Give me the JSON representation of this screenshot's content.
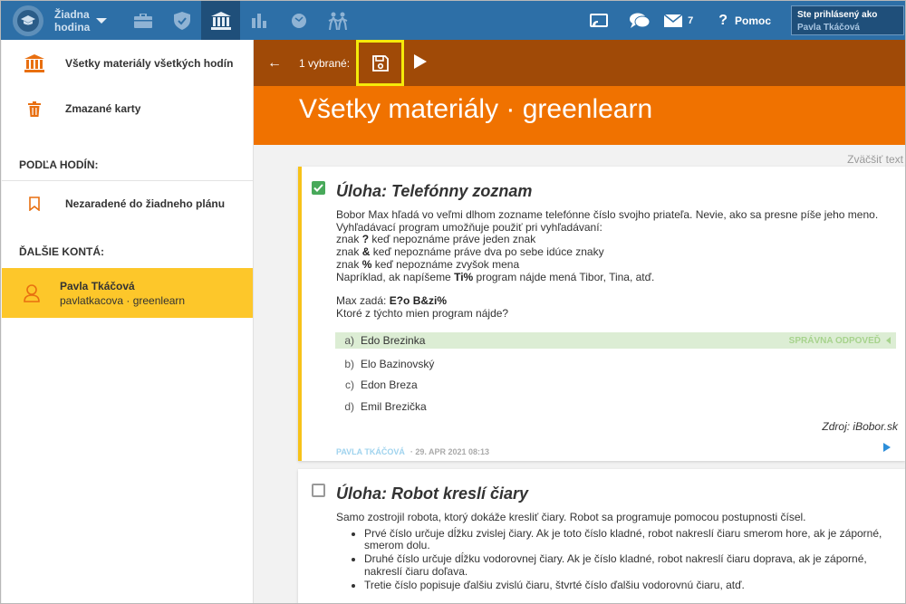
{
  "topbar": {
    "hour_line1": "Žiadna",
    "hour_line2": "hodina",
    "icons": [
      "briefcase-icon",
      "shield-check-icon",
      "bank-icon",
      "bar-chart-icon",
      "tomato-icon",
      "children-icon"
    ],
    "message_count": "7",
    "help_label": "Pomoc",
    "help_mark": "?",
    "signed_in_label": "Ste prihlásený ako",
    "signed_in_user": "Pavla Tkáčová"
  },
  "sidebar": {
    "item_all": "Všetky materiály všetkých hodín",
    "item_deleted": "Zmazané karty",
    "section_by_hour": "PODĽA HODÍN:",
    "item_unassigned": "Nezaradené do žiadneho plánu",
    "section_accounts": "ĎALŠIE KONTÁ:",
    "account_name": "Pavla Tkáčová",
    "account_sub": "pavlatkacova · greenlearn"
  },
  "actionbar": {
    "back_arrow": "←",
    "selected": "1 vybrané:"
  },
  "title": "Všetky materiály · greenlearn",
  "zoom_label": "Zväčšiť text",
  "card1": {
    "checked": true,
    "title": "Úloha: Telefónny zoznam",
    "p1": "Bobor Max hľadá vo veľmi dlhom zozname telefónne číslo svojho priateľa. Nevie, ako sa presne píše jeho meno.",
    "p2": "Vyhľadávací program umožňuje použiť pri vyhľadávaní:",
    "l1_pre": "znak ",
    "l1_b": "?",
    "l1_post": " keď nepoznáme práve jeden znak",
    "l2_pre": "znak ",
    "l2_b": "&",
    "l2_post": " keď nepoznáme práve dva po sebe idúce znaky",
    "l3_pre": "znak ",
    "l3_b": "%",
    "l3_post": " keď nepoznáme zvyšok mena",
    "l4_pre": "Napríklad, ak napíšeme ",
    "l4_b": "Ti%",
    "l4_post": " program nájde mená Tibor, Tina, atď.",
    "q_pre": "Max zadá: ",
    "q_b": "E?o B&zi%",
    "q2": "Ktoré z týchto mien program nájde?",
    "options": [
      {
        "letter": "a)",
        "text": "Edo Brezinka"
      },
      {
        "letter": "b)",
        "text": "Elo Bazinovský"
      },
      {
        "letter": "c)",
        "text": "Edon Breza"
      },
      {
        "letter": "d)",
        "text": "Emil Brezička"
      }
    ],
    "correct_label": "SPRÁVNA ODPOVEĎ",
    "source": "Zdroj: iBobor.sk",
    "author": "PAVLA TKÁČOVÁ",
    "date": "· 29. APR 2021 08:13"
  },
  "card2": {
    "checked": false,
    "title": "Úloha: Robot kreslí čiary",
    "p1": "Samo zostrojil robota, ktorý dokáže kresliť čiary. Robot sa programuje pomocou postupnosti čísel.",
    "bullets": [
      "Prvé číslo určuje dĺžku zvislej čiary. Ak je toto číslo kladné, robot nakreslí čiaru smerom hore, ak je záporné, smerom dolu.",
      "Druhé číslo určuje dĺžku vodorovnej čiary. Ak je číslo kladné, robot nakreslí čiaru doprava, ak je záporné, nakreslí čiaru doľava.",
      "Tretie číslo popisuje ďalšiu zvislú čiaru, štvrté číslo ďalšiu vodorovnú čiaru, atď."
    ]
  },
  "colors": {
    "topbar": "#2d6fa7",
    "actionbar": "#a04a07",
    "title": "#f07200",
    "highlight": "#fdc72a"
  }
}
